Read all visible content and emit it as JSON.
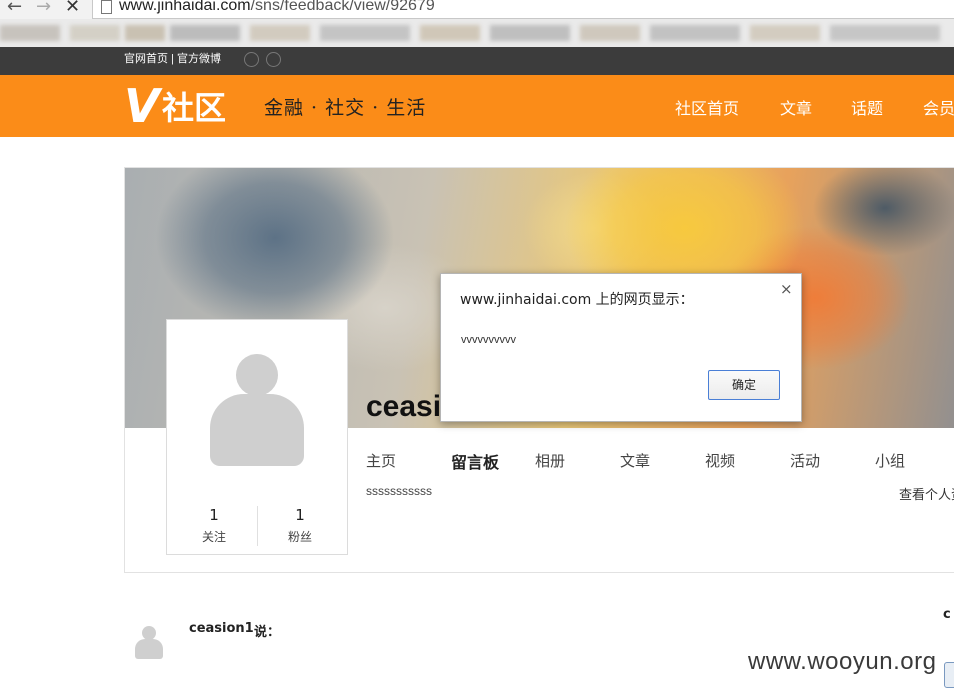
{
  "browser": {
    "url_domain": "www.jinhaidai.com",
    "url_path": "/sns/feedback/view/92679",
    "back_icon": "←",
    "forward_icon": "→",
    "stop_icon": "✕"
  },
  "topbar": {
    "links": "官网首页 | 官方微博"
  },
  "header": {
    "logo_mark": "V",
    "logo_text": "社区",
    "slogan": "金融 · 社交 · 生活",
    "nav": [
      "社区首页",
      "文章",
      "话题",
      "会员"
    ]
  },
  "profile": {
    "username": "ceasion1",
    "follow_count": "1",
    "follow_label": "关注",
    "fans_count": "1",
    "fans_label": "粉丝",
    "tabs": [
      "主页",
      "留言板",
      "相册",
      "文章",
      "视频",
      "活动",
      "小组"
    ],
    "active_tab": "留言板",
    "signature": "sssssssssss",
    "view_more": "查看个人资"
  },
  "comment": {
    "author": "ceasion1",
    "says": "说："
  },
  "edge_text": "c",
  "watermark": "www.wooyun.org",
  "dialog": {
    "title": "www.jinhaidai.com 上的网页显示：",
    "message": "vvvvvvvvvv",
    "ok_label": "确定",
    "close_icon": "×"
  },
  "colors": {
    "brand_orange": "#fb8c18",
    "top_strip": "#3c3c3c",
    "dialog_button_border": "#4a7fd6"
  }
}
